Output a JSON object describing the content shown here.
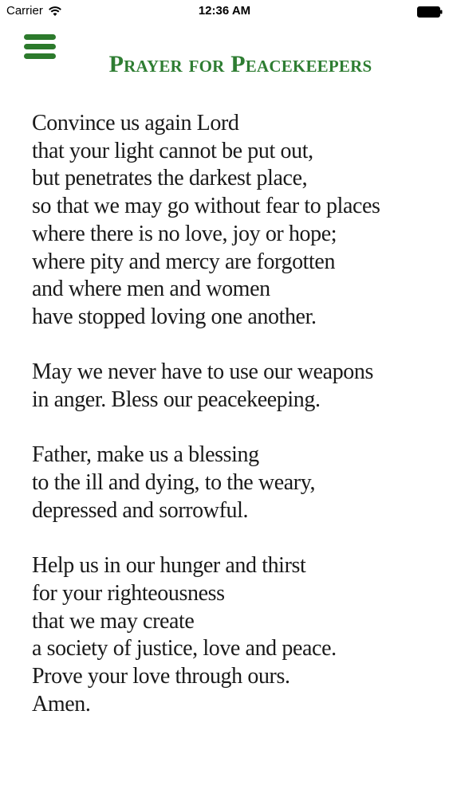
{
  "status_bar": {
    "carrier": "Carrier",
    "time": "12:36 AM",
    "wifi_icon": "wifi-icon",
    "battery_icon": "battery-icon"
  },
  "header": {
    "menu_icon": "hamburger-menu-icon",
    "title": "Prayer for Peacekeepers",
    "title_color": "#2e7d32"
  },
  "prayer": {
    "stanzas": [
      {
        "lines": [
          "Convince us again Lord",
          "that your light cannot be put out,",
          "but penetrates the darkest place,",
          "so that we may go without fear to places",
          "where there is no love, joy or hope;",
          "where pity and mercy are forgotten",
          "and where men and women",
          "have stopped loving one another."
        ]
      },
      {
        "lines": [
          "May we never have to use our weapons",
          "in anger. Bless our peacekeeping."
        ]
      },
      {
        "lines": [
          "Father, make us a blessing",
          "to the ill and dying, to the weary,",
          "depressed and sorrowful."
        ]
      },
      {
        "lines": [
          "Help us in our hunger and thirst",
          "for your righteousness",
          "that we may create",
          "a society of justice, love and peace.",
          "Prove your love through ours.",
          "Amen."
        ]
      }
    ]
  }
}
